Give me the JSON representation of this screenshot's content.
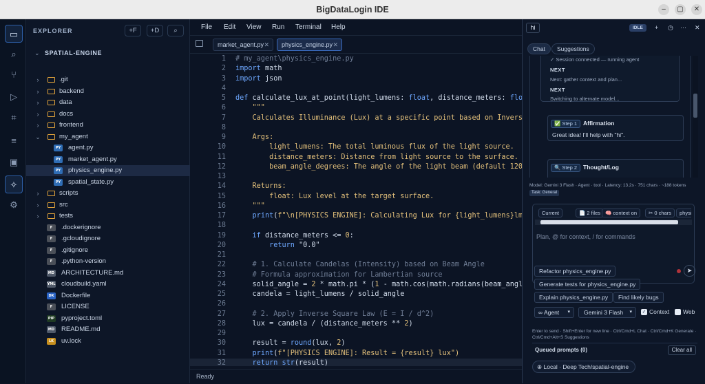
{
  "window": {
    "title": "BigDataLogin IDE",
    "minimize": "–",
    "maximize": "▢",
    "close": "✕"
  },
  "activity": {
    "items": [
      {
        "name": "files-icon",
        "glyph": "▭"
      },
      {
        "name": "search-icon",
        "glyph": "⌕"
      },
      {
        "name": "source-control-icon",
        "glyph": "⑂"
      },
      {
        "name": "run-icon",
        "glyph": "▷"
      },
      {
        "name": "extensions-icon",
        "glyph": "⌗"
      },
      {
        "name": "outline-icon",
        "glyph": "≡"
      },
      {
        "name": "database-icon",
        "glyph": "▣"
      },
      {
        "name": "agent-icon",
        "glyph": "✧"
      },
      {
        "name": "settings-icon",
        "glyph": "⚙"
      }
    ]
  },
  "explorer": {
    "header": "EXPLORER",
    "new_file": "+F",
    "new_folder": "+D",
    "search": "⌕",
    "project": "SPATIAL-ENGINE",
    "tree": [
      {
        "name": ".git",
        "kind": "folder",
        "depth": 0
      },
      {
        "name": "backend",
        "kind": "folder",
        "depth": 0
      },
      {
        "name": "data",
        "kind": "folder",
        "depth": 0
      },
      {
        "name": "docs",
        "kind": "folder",
        "depth": 0
      },
      {
        "name": "frontend",
        "kind": "folder",
        "depth": 0
      },
      {
        "name": "my_agent",
        "kind": "folder-open",
        "depth": 0
      },
      {
        "name": "agent.py",
        "kind": "file",
        "badge": "PY",
        "color": "#2f6db5",
        "depth": 1
      },
      {
        "name": "market_agent.py",
        "kind": "file",
        "badge": "PY",
        "color": "#2f6db5",
        "depth": 1
      },
      {
        "name": "physics_engine.py",
        "kind": "file",
        "badge": "PY",
        "color": "#2f6db5",
        "depth": 1,
        "selected": true
      },
      {
        "name": "spatial_state.py",
        "kind": "file",
        "badge": "PY",
        "color": "#2f6db5",
        "depth": 1
      },
      {
        "name": "scripts",
        "kind": "folder",
        "depth": 0
      },
      {
        "name": "src",
        "kind": "folder",
        "depth": 0
      },
      {
        "name": "tests",
        "kind": "folder",
        "depth": 0
      },
      {
        "name": ".dockerignore",
        "kind": "file",
        "badge": "F",
        "color": "#4a4f58",
        "depth": 0
      },
      {
        "name": ".gcloudignore",
        "kind": "file",
        "badge": "F",
        "color": "#4a4f58",
        "depth": 0
      },
      {
        "name": ".gitignore",
        "kind": "file",
        "badge": "F",
        "color": "#4a4f58",
        "depth": 0
      },
      {
        "name": ".python-version",
        "kind": "file",
        "badge": "F",
        "color": "#4a4f58",
        "depth": 0
      },
      {
        "name": "ARCHITECTURE.md",
        "kind": "file",
        "badge": "MD",
        "color": "#505a6a",
        "depth": 0
      },
      {
        "name": "cloudbuild.yaml",
        "kind": "file",
        "badge": "YML",
        "color": "#505a6a",
        "depth": 0
      },
      {
        "name": "Dockerfile",
        "kind": "file",
        "badge": "DK",
        "color": "#2a63c4",
        "depth": 0
      },
      {
        "name": "LICENSE",
        "kind": "file",
        "badge": "F",
        "color": "#4a4f58",
        "depth": 0
      },
      {
        "name": "pyproject.toml",
        "kind": "file",
        "badge": "PIP",
        "color": "#1f3a24",
        "depth": 0
      },
      {
        "name": "README.md",
        "kind": "file",
        "badge": "MD",
        "color": "#505a6a",
        "depth": 0
      },
      {
        "name": "uv.lock",
        "kind": "file",
        "badge": "LK",
        "color": "#c8901e",
        "depth": 0
      }
    ]
  },
  "editor": {
    "menu": [
      "File",
      "Edit",
      "View",
      "Run",
      "Terminal",
      "Help"
    ],
    "tabs": [
      {
        "label": "market_agent.py",
        "close": "✕",
        "active": false
      },
      {
        "label": "physics_engine.py",
        "close": "✕",
        "active": true
      }
    ],
    "lines": [
      {
        "n": "1",
        "t": "# my_agent\\physics_engine.py",
        "c": "cm"
      },
      {
        "n": "2",
        "t": "import math",
        "c": "imp"
      },
      {
        "n": "3",
        "t": "import json",
        "c": "imp"
      },
      {
        "n": "4",
        "t": "",
        "c": ""
      },
      {
        "n": "5",
        "t": "def calculate_lux_at_point(light_lumens: float, distance_meters: float",
        "c": "def"
      },
      {
        "n": "6",
        "t": "    \"\"\"",
        "c": "str"
      },
      {
        "n": "7",
        "t": "    Calculates Illuminance (Lux) at a specific point based on Inverse",
        "c": "str"
      },
      {
        "n": "8",
        "t": "",
        "c": ""
      },
      {
        "n": "9",
        "t": "    Args:",
        "c": "str"
      },
      {
        "n": "10",
        "t": "        light_lumens: The total luminous flux of the light source.",
        "c": "str"
      },
      {
        "n": "11",
        "t": "        distance_meters: Distance from light source to the surface.",
        "c": "str"
      },
      {
        "n": "12",
        "t": "        beam_angle_degrees: The angle of the light beam (default 120",
        "c": "str"
      },
      {
        "n": "13",
        "t": "",
        "c": ""
      },
      {
        "n": "14",
        "t": "    Returns:",
        "c": "str"
      },
      {
        "n": "15",
        "t": "        float: Lux level at the target surface.",
        "c": "str"
      },
      {
        "n": "16",
        "t": "    \"\"\"",
        "c": "str"
      },
      {
        "n": "17",
        "t": "    print(f\"\\n[PHYSICS ENGINE]: Calculating Lux for {light_lumens}lm",
        "c": "print"
      },
      {
        "n": "18",
        "t": "",
        "c": ""
      },
      {
        "n": "19",
        "t": "    if distance_meters <= 0:",
        "c": "if"
      },
      {
        "n": "20",
        "t": "        return \"0.0\"",
        "c": "ret"
      },
      {
        "n": "21",
        "t": "",
        "c": ""
      },
      {
        "n": "22",
        "t": "    # 1. Calculate Candelas (Intensity) based on Beam Angle",
        "c": "cm"
      },
      {
        "n": "23",
        "t": "    # Formula approximation for Lambertian source",
        "c": "cm"
      },
      {
        "n": "24",
        "t": "    solid_angle = 2 * math.pi * (1 - math.cos(math.radians(beam_angl",
        "c": "plain"
      },
      {
        "n": "25",
        "t": "    candela = light_lumens / solid_angle",
        "c": "plain"
      },
      {
        "n": "26",
        "t": "",
        "c": ""
      },
      {
        "n": "27",
        "t": "    # 2. Apply Inverse Square Law (E = I / d^2)",
        "c": "cm"
      },
      {
        "n": "28",
        "t": "    lux = candela / (distance_meters ** 2)",
        "c": "plain"
      },
      {
        "n": "29",
        "t": "",
        "c": ""
      },
      {
        "n": "30",
        "t": "    result = round(lux, 2)",
        "c": "plain"
      },
      {
        "n": "31",
        "t": "    print(f\"[PHYSICS ENGINE]: Result = {result} lux\")",
        "c": "print"
      },
      {
        "n": "32",
        "t": "    return str(result)",
        "c": "ret"
      }
    ],
    "status": "Ready"
  },
  "panel": {
    "tab_title": "hi",
    "state": "IDLE",
    "add": "+",
    "history": "◷",
    "more": "···",
    "close": "✕",
    "chat_tab": "Chat",
    "suggestions_tab": "Suggestions",
    "log": {
      "session": "Session connected — running agent",
      "next1_label": "NEXT",
      "next1_text": "Next: gather context and plan...",
      "next2_label": "NEXT",
      "next2_text": "Switching to alternate model..."
    },
    "step1": {
      "badge": "✅ Step 1",
      "title": "Affirmation",
      "text": "Great idea! I'll help with \"hi\"."
    },
    "step2": {
      "badge": "🔍 Step 2",
      "title": "Thought/Log"
    },
    "model_info": "Model: Gemini 3 Flash · Agent · tool · Latency: 13.2s · 751 chars · ~188 tokens",
    "task_badge": "Task: General",
    "context_chips": [
      "Current",
      "📄 2 files",
      "🧠 context on",
      "✂ 0 chars",
      "physic"
    ],
    "input_placeholder": "Plan, @ for context, / for commands",
    "suggestions": [
      "Refactor physics_engine.py",
      "Generate tests for physics_engine.py",
      "Explain physics_engine.py",
      "Find likely bugs"
    ],
    "mode": "∞ Agent",
    "model": "Gemini 3 Flash",
    "context_label": "Context",
    "context_checked": true,
    "web_label": "Web",
    "web_checked": false,
    "help": "Enter to send · Shift+Enter for new line · Ctrl/Cmd+L Chat · Ctrl/Cmd+K Generate · Ctrl/Cmd+Alt+S Suggestions",
    "queued": "Queued prompts (0)",
    "clear_all": "Clear all",
    "workspace": "Local · Deep Tech/spatial-engine"
  }
}
